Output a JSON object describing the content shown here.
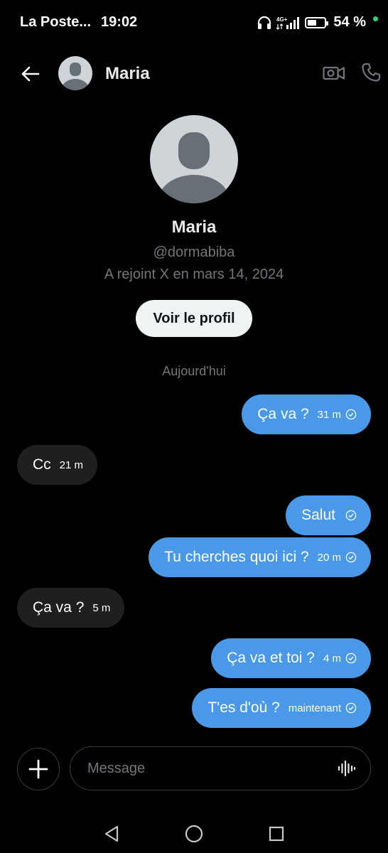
{
  "status_bar": {
    "carrier": "La Poste...",
    "time": "19:02",
    "network": "4G+",
    "battery_percent": "54 %",
    "battery_level": 0.54
  },
  "header": {
    "name": "Maria",
    "icons": [
      "back-arrow-icon",
      "avatar",
      "video-camera-icon",
      "phone-icon"
    ]
  },
  "profile": {
    "name": "Maria",
    "handle": "@dormabiba",
    "joined": "A rejoint X en mars 14, 2024",
    "view_button": "Voir le profil"
  },
  "day_label": "Aujourd'hui",
  "messages": [
    {
      "direction": "out",
      "text": "Ça va ?",
      "time": "31 m",
      "read": true
    },
    {
      "direction": "in",
      "text": "Cc",
      "time": "21 m"
    },
    {
      "direction": "out",
      "text": "Salut",
      "time": "",
      "read": true
    },
    {
      "direction": "out",
      "text": "Tu cherches quoi ici ?",
      "time": "20 m",
      "read": true
    },
    {
      "direction": "in",
      "text": "Ça va ?",
      "time": "5 m"
    },
    {
      "direction": "out",
      "text": "Ça va et toi ?",
      "time": "4 m",
      "read": true
    },
    {
      "direction": "out",
      "text": "T'es d'où ?",
      "time": "maintenant",
      "read": true
    }
  ],
  "composer": {
    "placeholder": "Message"
  },
  "colors": {
    "outgoing_bubble": "#4a99e9",
    "incoming_bubble": "#1f1f1f",
    "background": "#000000"
  }
}
